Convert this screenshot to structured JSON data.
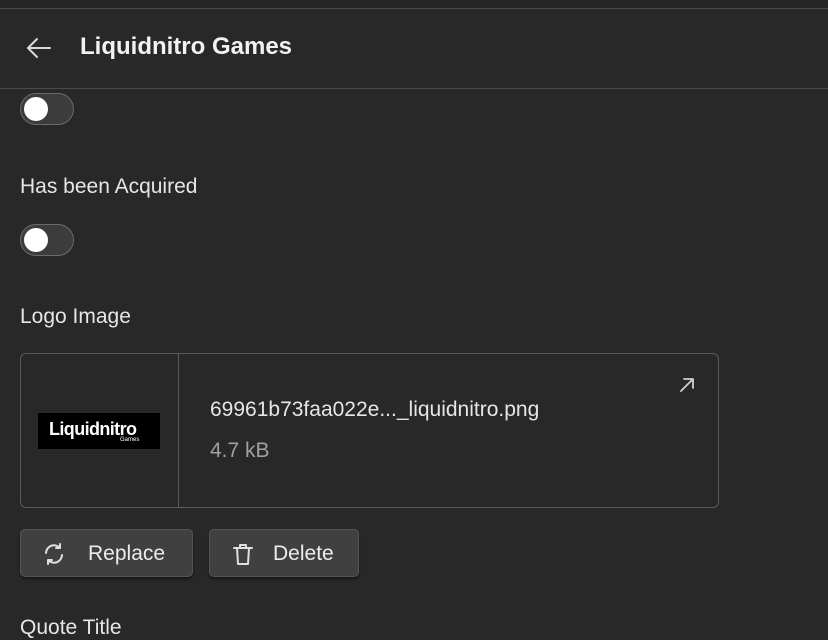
{
  "header": {
    "title": "Liquidnitro Games"
  },
  "fields": {
    "first_toggle": {
      "checked": false
    },
    "acquired": {
      "label": "Has been Acquired",
      "checked": false
    },
    "logo": {
      "label": "Logo Image",
      "file_name": "69961b73faa022e..._liquidnitro.png",
      "file_size": "4.7 kB",
      "thumbnail_text": "Liquidnitro",
      "thumbnail_subtext": "Games",
      "replace_label": "Replace",
      "delete_label": "Delete"
    },
    "quote_title": {
      "label": "Quote Title"
    }
  },
  "icons": {
    "back": "arrow-left-icon",
    "open": "external-link-icon",
    "replace": "refresh-icon",
    "delete": "trash-icon"
  }
}
